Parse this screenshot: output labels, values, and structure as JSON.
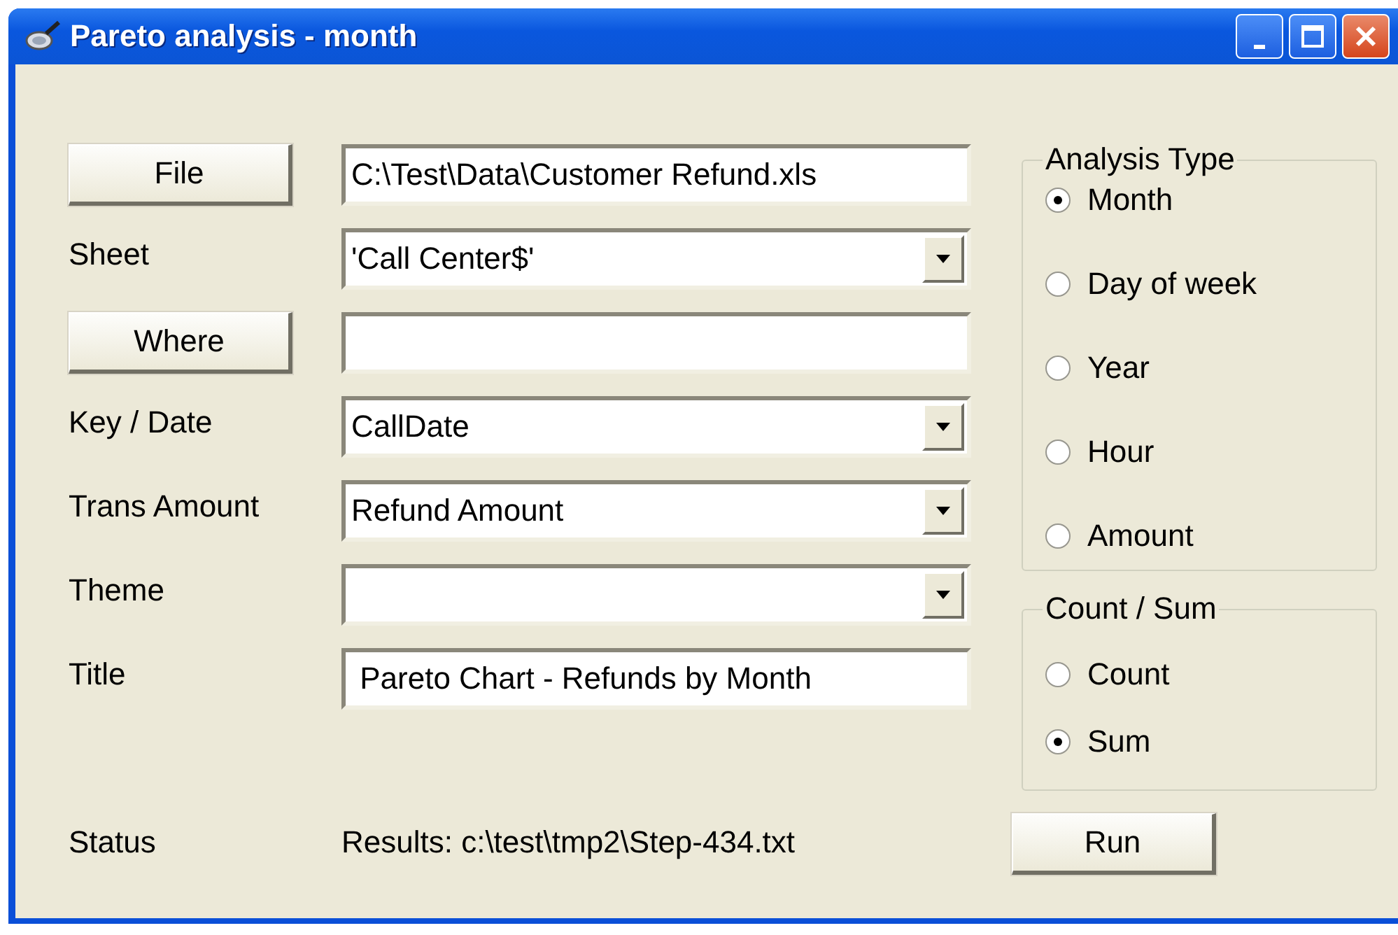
{
  "window": {
    "title": "Pareto analysis - month"
  },
  "rows": [
    {
      "label": {
        "kind": "button",
        "text": "File"
      },
      "field": {
        "kind": "text",
        "value": "C:\\Test\\Data\\Customer Refund.xls"
      }
    },
    {
      "label": {
        "kind": "label",
        "text": "Sheet"
      },
      "field": {
        "kind": "combo",
        "value": "'Call Center$'"
      }
    },
    {
      "label": {
        "kind": "button",
        "text": "Where"
      },
      "field": {
        "kind": "text"
      }
    },
    {
      "label": {
        "kind": "label",
        "text": "Key / Date"
      },
      "field": {
        "kind": "combo",
        "value": "CallDate"
      }
    },
    {
      "label": {
        "kind": "label",
        "text": "Trans Amount"
      },
      "field": {
        "kind": "combo",
        "value": "Refund Amount"
      }
    },
    {
      "label": {
        "kind": "label",
        "text": "Theme"
      },
      "field": {
        "kind": "combo"
      }
    },
    {
      "label": {
        "kind": "label",
        "text": "Title"
      },
      "field": {
        "kind": "text",
        "value": " Pareto Chart - Refunds by Month"
      }
    }
  ],
  "status": {
    "label": "Status",
    "text": "Results: c:\\test\\tmp2\\Step-434.txt"
  },
  "groups": [
    {
      "label": "Analysis Type",
      "options": [
        {
          "label": "Month",
          "selected": true
        },
        {
          "label": "Day of week",
          "selected": false
        },
        {
          "label": "Year",
          "selected": false
        },
        {
          "label": "Hour",
          "selected": false
        },
        {
          "label": "Amount",
          "selected": false
        }
      ]
    },
    {
      "label": "Count / Sum",
      "options": [
        {
          "label": "Count",
          "selected": false
        },
        {
          "label": "Sum",
          "selected": true
        }
      ]
    }
  ],
  "run_button": "Run"
}
